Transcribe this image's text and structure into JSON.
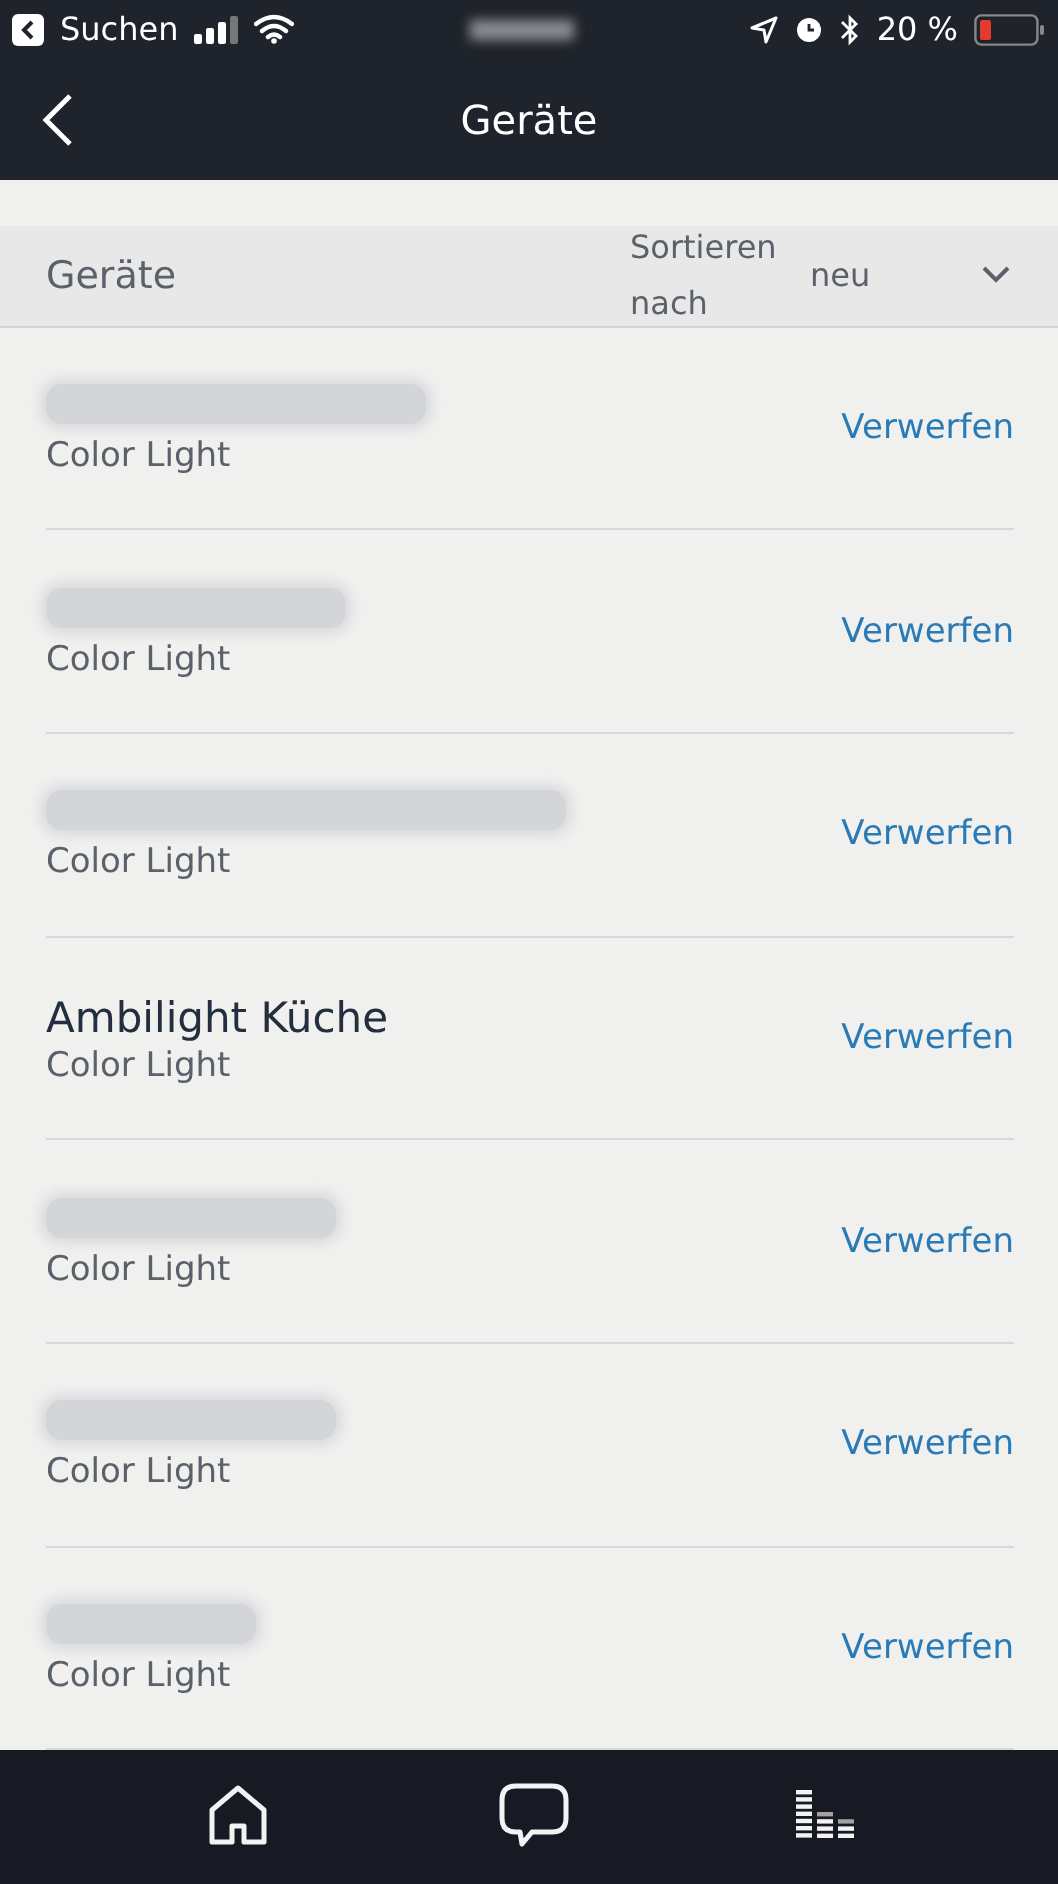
{
  "status_bar": {
    "back_label": "Suchen",
    "battery": "20 %"
  },
  "nav": {
    "title": "Geräte"
  },
  "sort_header": {
    "title": "Geräte",
    "sort_label": "Sortieren nach",
    "sort_value": "neu"
  },
  "devices": [
    {
      "redacted": true,
      "type": "Color Light",
      "action": "Verwerfen"
    },
    {
      "redacted": true,
      "type": "Color Light",
      "action": "Verwerfen"
    },
    {
      "redacted": true,
      "type": "Color Light",
      "action": "Verwerfen"
    },
    {
      "redacted": false,
      "name": "Ambilight Küche",
      "type": "Color Light",
      "action": "Verwerfen"
    },
    {
      "redacted": true,
      "type": "Color Light",
      "action": "Verwerfen"
    },
    {
      "redacted": true,
      "type": "Color Light",
      "action": "Verwerfen"
    },
    {
      "redacted": true,
      "type": "Color Light",
      "action": "Verwerfen"
    }
  ],
  "tab_bar": [
    {
      "kind": "home",
      "selected": false
    },
    {
      "kind": "chat",
      "selected": false
    },
    {
      "kind": "activity",
      "selected": false
    }
  ]
}
